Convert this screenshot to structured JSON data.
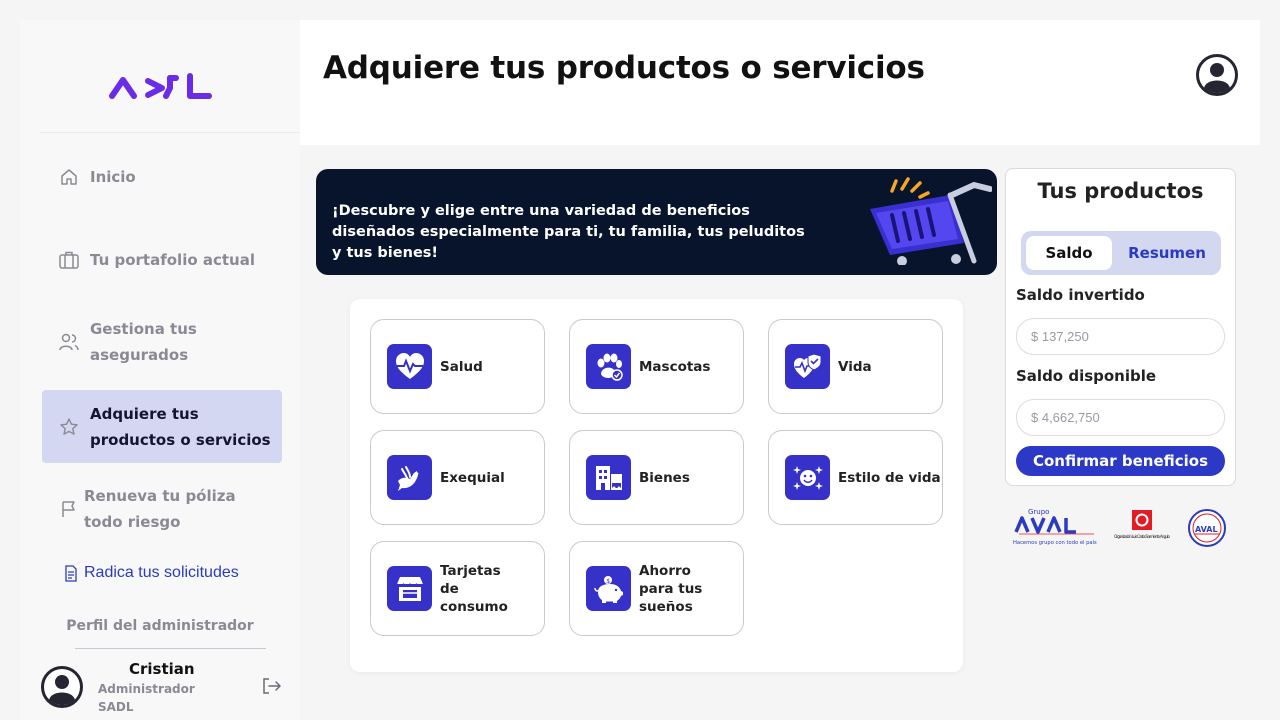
{
  "app": {
    "brand": "ADL",
    "page_title": "Adquiere tus productos o servicios"
  },
  "sidebar": {
    "items": [
      {
        "label": "Inicio",
        "icon": "home-icon",
        "active": false
      },
      {
        "label": "Tu portafolio actual",
        "icon": "briefcase-icon",
        "active": false
      },
      {
        "label": "Gestiona tus asegurados",
        "icon": "users-icon",
        "active": false
      },
      {
        "label": "Adquiere tus productos o servicios",
        "icon": "star-icon",
        "active": true
      },
      {
        "label": "Renueva tu póliza todo riesgo",
        "icon": "flag-icon",
        "active": false
      }
    ],
    "radica_link": "Radica tus solicitudes",
    "profile_heading": "Perfil del administrador",
    "user": {
      "name": "Cristian",
      "role": "Administrador",
      "company": "SADL"
    }
  },
  "banner": {
    "text": "¡Descubre y elige entre una variedad de beneficios diseñados especialmente para ti, tu familia, tus peluditos y tus bienes!"
  },
  "categories": [
    {
      "label": "Salud",
      "icon": "heart-pulse-icon"
    },
    {
      "label": "Mascotas",
      "icon": "paw-icon"
    },
    {
      "label": "Vida",
      "icon": "life-shield-icon"
    },
    {
      "label": "Exequial",
      "icon": "dove-icon"
    },
    {
      "label": "Bienes",
      "icon": "buildings-icon"
    },
    {
      "label": "Estilo de vida",
      "icon": "smile-sparkle-icon"
    },
    {
      "label": "Tarjetas de consumo",
      "icon": "storefront-icon"
    },
    {
      "label": "Ahorro para tus sueños",
      "icon": "piggy-bank-icon"
    }
  ],
  "products_panel": {
    "title": "Tus productos",
    "tabs": {
      "active": "Saldo",
      "inactive": "Resumen"
    },
    "saldo_invertido_label": "Saldo invertido",
    "saldo_invertido_value": "$ 137,250",
    "saldo_disponible_label": "Saldo disponible",
    "saldo_disponible_value": "$ 4,662,750",
    "confirm_label": "Confirmar beneficios"
  },
  "partner_logos": {
    "aval_small": "Grupo",
    "aval_name": "AVAL",
    "aval_tagline": "Hacemos grupo con todo el país",
    "org_name": "Organización Luis Carlos Sarmiento Angulo",
    "fundacion": "AVAL"
  },
  "colors": {
    "primary": "#2c38c6",
    "icon_bg": "#3531c9",
    "banner_bg": "#07142b",
    "active_nav": "#d4d7f1"
  }
}
